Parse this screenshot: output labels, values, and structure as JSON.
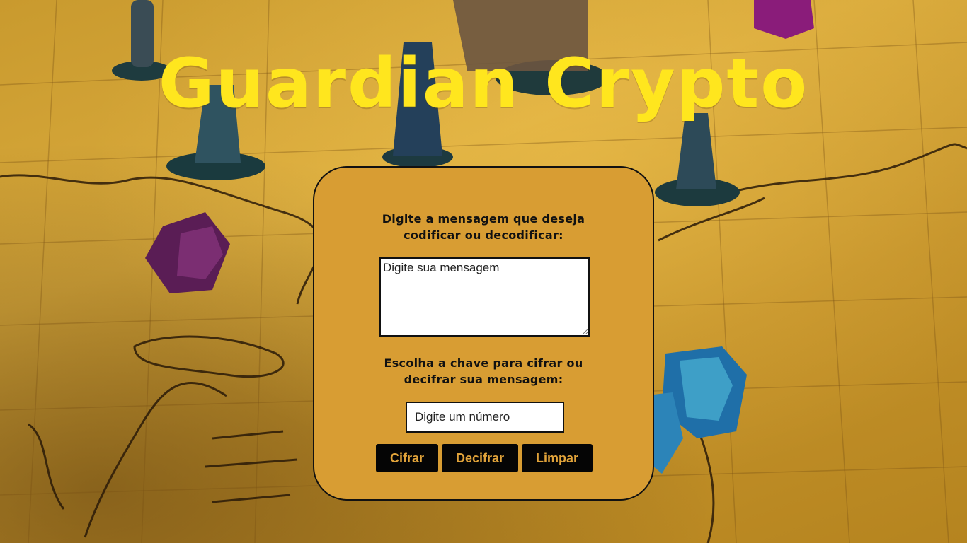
{
  "header": {
    "title": "Guardian Crypto"
  },
  "form": {
    "message_label_line1": "Digite a mensagem que deseja",
    "message_label_line2": "codificar ou decodificar:",
    "message_placeholder": "Digite sua mensagem",
    "key_label_line1": "Escolha a chave para cifrar ou",
    "key_label_line2": "decifrar sua mensagem:",
    "key_placeholder": "Digite um número"
  },
  "buttons": {
    "encrypt": "Cifrar",
    "decrypt": "Decifrar",
    "clear": "Limpar"
  },
  "colors": {
    "title": "#ffe61e",
    "panel": "#d89d33",
    "button_bg": "#050505",
    "button_text": "#e1a33a"
  },
  "background": {
    "icons": [
      "game-board-map",
      "miniature-figures",
      "dice"
    ]
  }
}
